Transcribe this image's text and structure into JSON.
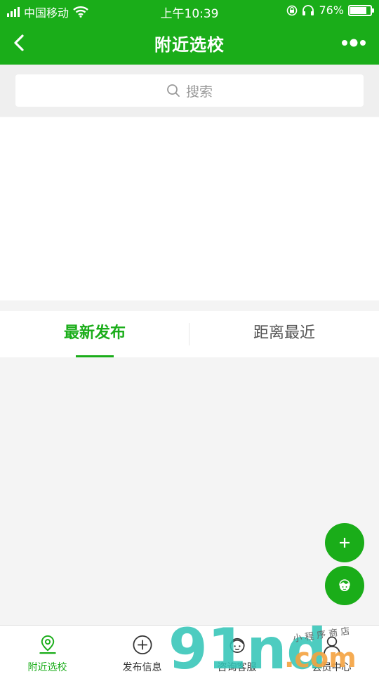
{
  "status_bar": {
    "carrier": "中国移动",
    "time": "上午10:39",
    "battery": "76%",
    "battery_level": 0.76
  },
  "nav": {
    "title": "附近选校",
    "back_icon": "chevron-left-icon",
    "more_icon": "more-dots-icon"
  },
  "search": {
    "placeholder": "搜索"
  },
  "tabs": [
    {
      "label": "最新发布",
      "active": true
    },
    {
      "label": "距离最近",
      "active": false
    }
  ],
  "fabs": [
    {
      "icon": "plus-icon"
    },
    {
      "icon": "customer-service-icon"
    }
  ],
  "tabbar": {
    "items": [
      {
        "label": "附近选校",
        "icon": "location-pin-icon",
        "active": true
      },
      {
        "label": "发布信息",
        "icon": "plus-circle-icon",
        "active": false
      },
      {
        "label": "咨询客服",
        "icon": "service-avatar-icon",
        "active": false
      },
      {
        "label": "会员中心",
        "icon": "user-icon",
        "active": false
      }
    ]
  },
  "colors": {
    "brand": "#1aad19",
    "background": "#f4f4f4",
    "text_secondary": "#999999"
  },
  "watermark": {
    "brand": "91nd",
    "domain": ".com",
    "tagline": "小 程 序 商 店"
  }
}
